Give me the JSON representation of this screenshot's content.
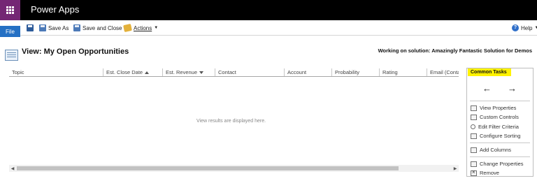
{
  "app": {
    "title": "Power Apps"
  },
  "ribbon": {
    "file_label": "File",
    "save_as_label": "Save As",
    "save_close_label": "Save and Close",
    "actions_label": "Actions",
    "help_label": "Help"
  },
  "view": {
    "title": "View: My Open Opportunities",
    "solution_text": "Working on solution: Amazingly Fantastic Solution for Demos"
  },
  "grid": {
    "columns": [
      {
        "label": "Topic",
        "sort": ""
      },
      {
        "label": "Est. Close Date",
        "sort": "asc"
      },
      {
        "label": "Est. Revenue",
        "sort": "desc"
      },
      {
        "label": "Contact",
        "sort": ""
      },
      {
        "label": "Account",
        "sort": ""
      },
      {
        "label": "Probability",
        "sort": ""
      },
      {
        "label": "Rating",
        "sort": ""
      },
      {
        "label": "Email (Conta",
        "sort": ""
      }
    ],
    "empty_message": "View results are displayed here."
  },
  "common_tasks": {
    "title": "Common Tasks",
    "back_arrow": "←",
    "forward_arrow": "→",
    "items": [
      {
        "label": "View Properties",
        "icon": "view-properties-icon"
      },
      {
        "label": "Custom Controls",
        "icon": "custom-controls-icon"
      },
      {
        "label": "Edit Filter Criteria",
        "icon": "search-icon"
      },
      {
        "label": "Configure Sorting",
        "icon": "sorting-icon"
      },
      {
        "label": "Add Columns",
        "icon": "add-columns-icon"
      },
      {
        "label": "Change Properties",
        "icon": "change-properties-icon"
      },
      {
        "label": "Remove",
        "icon": "remove-icon"
      }
    ]
  },
  "colors": {
    "waffle_bg": "#742774",
    "appbar_bg": "#000000",
    "file_button_bg": "#2570c4",
    "tasks_title_highlight": "#fff200"
  }
}
